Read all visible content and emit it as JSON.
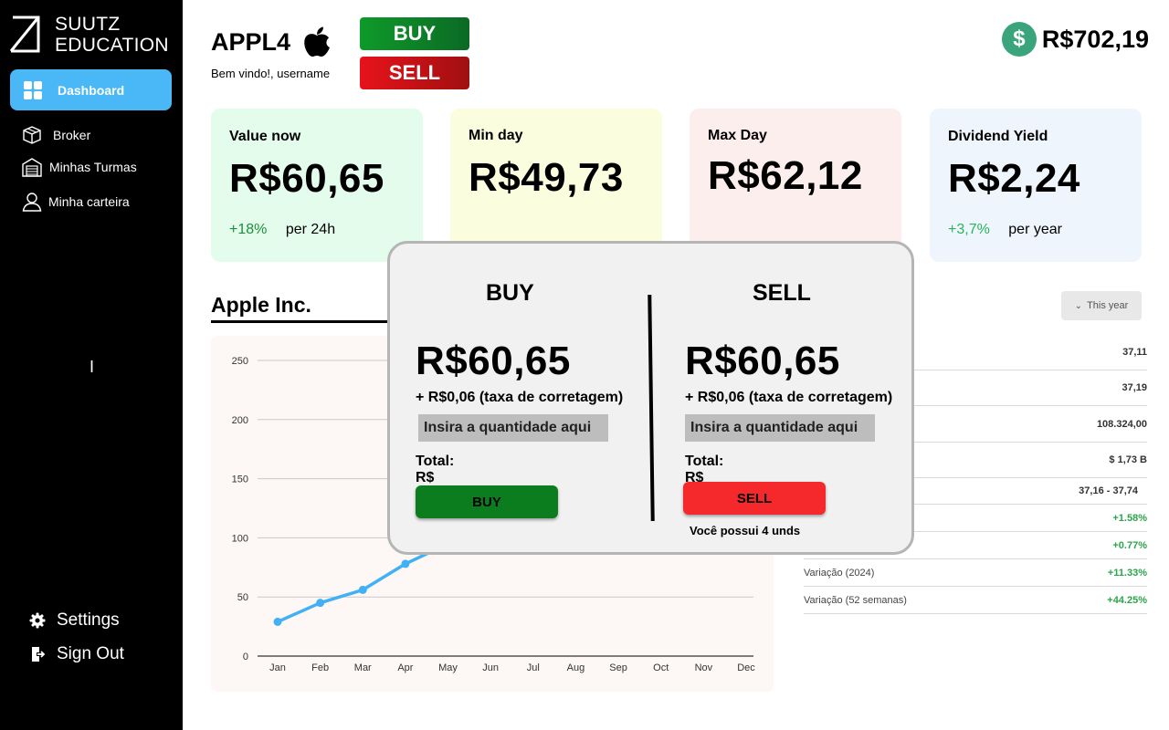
{
  "brand": {
    "line1": "SUUTZ",
    "line2": "EDUCATION"
  },
  "sidebar": {
    "active": {
      "label": "Dashboard",
      "icon": "grid-icon"
    },
    "items": [
      {
        "label": "Broker",
        "icon": "box-icon"
      },
      {
        "label": "Minhas Turmas",
        "icon": "garage-icon"
      },
      {
        "label": "Minha carteira",
        "icon": "user-icon"
      }
    ],
    "cursor_text": "I",
    "bottom": [
      {
        "label": "Settings",
        "icon": "gear-icon"
      },
      {
        "label": "Sign Out",
        "icon": "sign-out-icon"
      }
    ]
  },
  "header": {
    "ticker": "APPL4",
    "welcome": "Bem vindo!, username",
    "buy_label": "BUY",
    "sell_label": "SELL",
    "balance_symbol": "$",
    "balance": "R$702,19"
  },
  "cards": [
    {
      "title": "Value now",
      "value": "R$60,65",
      "delta": "+18%",
      "suffix": "per 24h",
      "bg": "#e3fceb"
    },
    {
      "title": "Min day",
      "value": "R$49,73",
      "delta": "",
      "suffix": "",
      "bg": "#fbfede"
    },
    {
      "title": "Max Day",
      "value": "R$62,12",
      "delta": "",
      "suffix": "",
      "bg": "#fdeeee"
    },
    {
      "title": "Dividend Yield",
      "value": "R$2,24",
      "delta": "+3,7%",
      "suffix": "per year",
      "bg": "#eef5fd"
    }
  ],
  "chart_section": {
    "title": "Apple Inc.",
    "period": "This year"
  },
  "chart_data": {
    "type": "line",
    "categories": [
      "Jan",
      "Feb",
      "Mar",
      "Apr",
      "May",
      "Jun",
      "Jul",
      "Aug",
      "Sep",
      "Oct",
      "Nov",
      "Dec"
    ],
    "series": [
      {
        "values": [
          29,
          45,
          56,
          78,
          95
        ]
      }
    ],
    "ylim": [
      0,
      250
    ],
    "yticks": [
      0,
      50,
      100,
      150,
      200,
      250
    ],
    "grid": true,
    "line_color": "#42b0f5"
  },
  "stats": [
    {
      "k": "",
      "v": "37,11",
      "pos": false
    },
    {
      "k": "",
      "v": "37,19",
      "pos": false
    },
    {
      "k": "",
      "v": "108.324,00",
      "pos": false
    },
    {
      "k": "",
      "v": "$ 1,73 B",
      "pos": false
    },
    {
      "k": "",
      "v": "37,16 - 37,74",
      "pos": false
    },
    {
      "k": "",
      "v": "+1.58%",
      "pos": true
    },
    {
      "k": "",
      "v": "+0.77%",
      "pos": true
    },
    {
      "k": "Variação (2024)",
      "v": "+11.33%",
      "pos": true
    },
    {
      "k": "Variação (52 semanas)",
      "v": "+44.25%",
      "pos": true
    }
  ],
  "modal": {
    "buy": {
      "title": "BUY",
      "price": "R$60,65",
      "fee": "+ R$0,06 (taxa de corretagem)",
      "placeholder": "Insira a quantidade aqui",
      "total": "Total: R$",
      "button": "BUY"
    },
    "sell": {
      "title": "SELL",
      "price": "R$60,65",
      "fee": "+ R$0,06 (taxa de corretagem)",
      "placeholder": "Insira a quantidade aqui",
      "total": "Total: R$",
      "button": "SELL",
      "note": "Você possui 4 unds"
    }
  }
}
